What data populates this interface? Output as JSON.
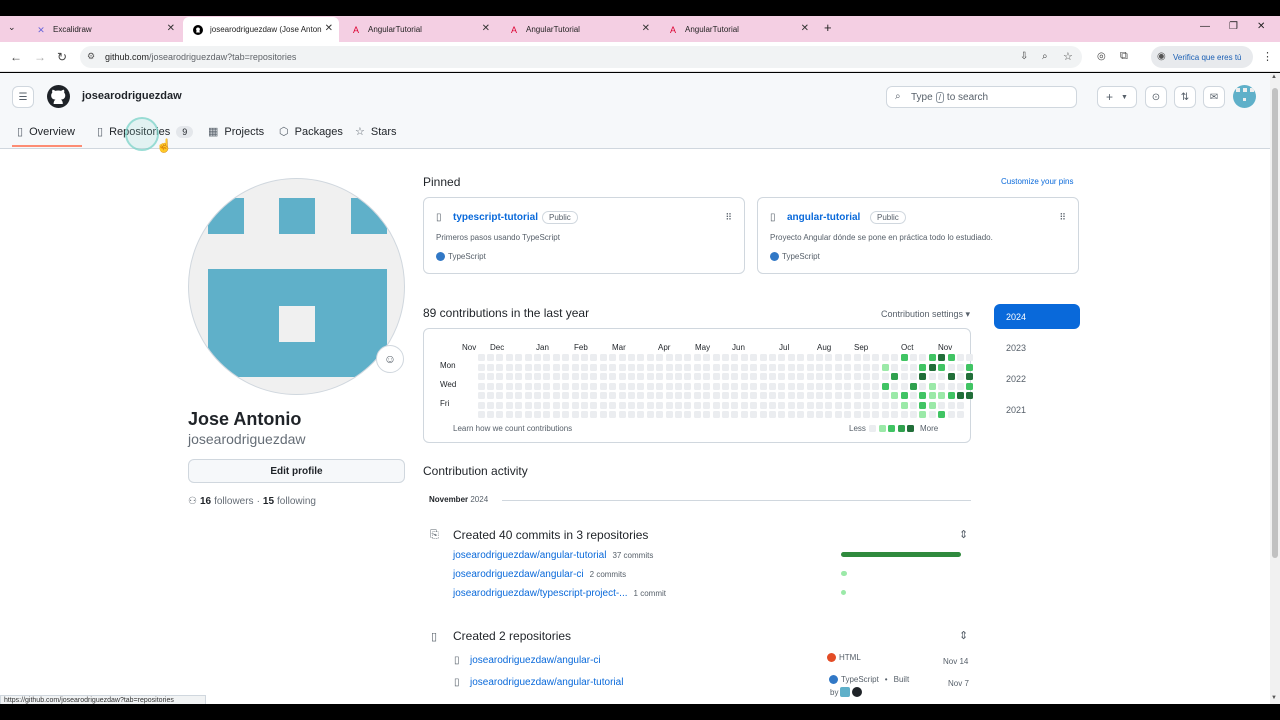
{
  "browser": {
    "tabs": [
      {
        "title": "Excalidraw",
        "icon": "excalidraw-icon"
      },
      {
        "title": "josearodriguezdaw (Jose Anton",
        "icon": "github-icon"
      },
      {
        "title": "AngularTutorial",
        "icon": "angular-icon"
      },
      {
        "title": "AngularTutorial",
        "icon": "angular-icon"
      },
      {
        "title": "AngularTutorial",
        "icon": "angular-icon"
      }
    ],
    "url_host": "github.com",
    "url_path": "/josearodriguezdaw?tab=repositories",
    "profile_chip": "Verifica que eres tú",
    "status_url": "https://github.com/josearodriguezdaw?tab=repositories"
  },
  "header": {
    "username": "josearodriguezdaw",
    "search_prefix": "Type",
    "search_key": "/",
    "search_suffix": "to search",
    "plus": "+"
  },
  "nav": {
    "overview": "Overview",
    "repositories": "Repositories",
    "repo_count": "9",
    "projects": "Projects",
    "packages": "Packages",
    "stars": "Stars"
  },
  "profile": {
    "name": "Jose Antonio",
    "login": "josearodriguezdaw",
    "edit_button": "Edit profile",
    "followers_count": "16",
    "followers_label": "followers",
    "sep": "·",
    "following_count": "15",
    "following_label": "following"
  },
  "pinned": {
    "title": "Pinned",
    "customize": "Customize your pins",
    "items": [
      {
        "name": "typescript-tutorial",
        "badge": "Public",
        "desc": "Primeros pasos usando TypeScript",
        "lang": "TypeScript",
        "lang_color": "#3178c6"
      },
      {
        "name": "angular-tutorial",
        "badge": "Public",
        "desc": "Proyecto Angular dónde se pone en práctica todo lo estudiado.",
        "lang": "TypeScript",
        "lang_color": "#3178c6"
      }
    ]
  },
  "contributions": {
    "title": "89 contributions in the last year",
    "settings": "Contribution settings ▾",
    "months": [
      "Nov",
      "Dec",
      "Jan",
      "Feb",
      "Mar",
      "Apr",
      "May",
      "Jun",
      "Jul",
      "Aug",
      "Sep",
      "Oct",
      "Nov"
    ],
    "days": [
      "Mon",
      "Wed",
      "Fri"
    ],
    "learn": "Learn how we count contributions",
    "less": "Less",
    "more": "More",
    "years": [
      "2024",
      "2023",
      "2022",
      "2021"
    ],
    "legend_colors": [
      "#ebedf0",
      "#9be9a8",
      "#40c463",
      "#30a14e",
      "#216e39"
    ]
  },
  "activity": {
    "title": "Contribution activity",
    "month": "November",
    "year": "2024",
    "commits_title": "Created 40 commits in 3 repositories",
    "commit_repos": [
      {
        "name": "josearodriguezdaw/angular-tutorial",
        "count": "37 commits",
        "share": 1.0
      },
      {
        "name": "josearodriguezdaw/angular-ci",
        "count": "2 commits",
        "share": 0.054
      },
      {
        "name": "josearodriguezdaw/typescript-project-...",
        "count": "1 commit",
        "share": 0.027
      }
    ],
    "repos_title": "Created 2 repositories",
    "created_repos": [
      {
        "name": "josearodriguezdaw/angular-ci",
        "lang": "HTML",
        "lang_color": "#e34c26",
        "date": "Nov 14"
      },
      {
        "name": "josearodriguezdaw/angular-tutorial",
        "lang": "TypeScript",
        "lang_color": "#3178c6",
        "extra": "Built",
        "by": "by",
        "date": "Nov 7"
      }
    ]
  }
}
